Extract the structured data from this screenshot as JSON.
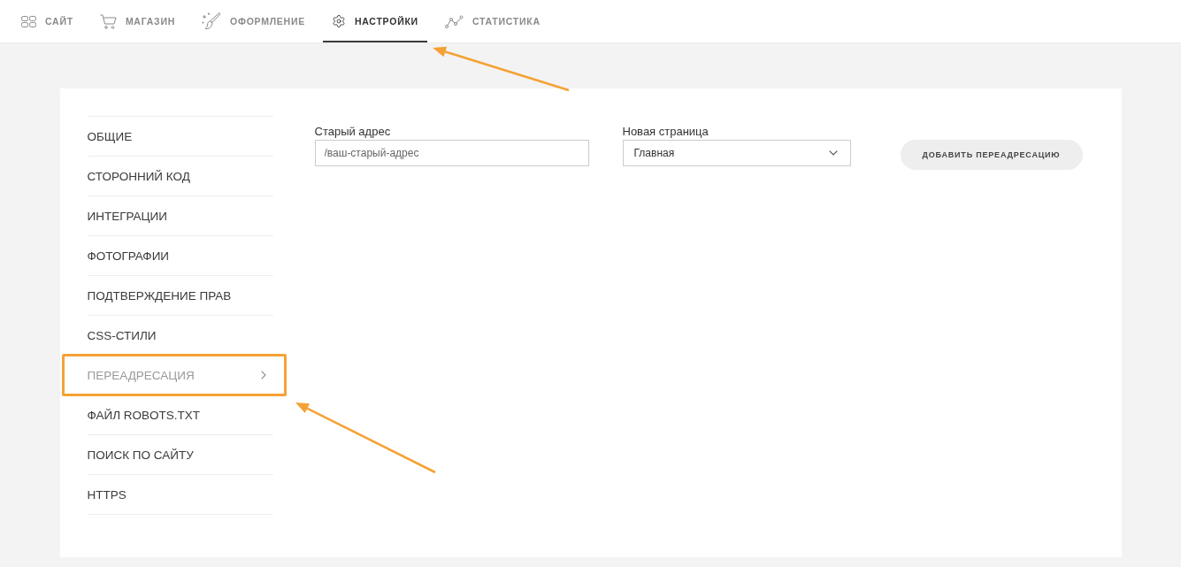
{
  "nav": {
    "pointer_arrow": true,
    "tabs": [
      {
        "label": "САЙТ",
        "selected": false
      },
      {
        "label": "МАГАЗИН",
        "selected": false
      },
      {
        "label": "ОФОРМЛЕНИЕ",
        "selected": false
      },
      {
        "label": "НАСТРОЙКИ",
        "selected": true
      },
      {
        "label": "СТАТИСТИКА",
        "selected": false
      }
    ]
  },
  "settings_menu": {
    "pointer_arrow": true,
    "highlight_frame": true,
    "items": [
      {
        "label": "ОБЩИЕ",
        "selected": false
      },
      {
        "label": "СТОРОННИЙ КОД",
        "selected": false
      },
      {
        "label": "ИНТЕГРАЦИИ",
        "selected": false
      },
      {
        "label": "ФОТОГРАФИИ",
        "selected": false
      },
      {
        "label": "ПОДТВЕРЖДЕНИЕ ПРАВ",
        "selected": false
      },
      {
        "label": "CSS-СТИЛИ",
        "selected": false
      },
      {
        "label": "ПЕРЕАДРЕСАЦИЯ",
        "selected": true
      },
      {
        "label": "ФАЙЛ ROBOTS.TXT",
        "selected": false
      },
      {
        "label": "ПОИСК ПО САЙТУ",
        "selected": false
      },
      {
        "label": "HTTPS",
        "selected": false
      }
    ]
  },
  "redirect_form": {
    "old_address": {
      "label": "Старый адрес",
      "placeholder": "/ваш-старый-адрес"
    },
    "new_page": {
      "label": "Новая страница",
      "value": "Главная"
    },
    "button": "ДОБАВИТЬ ПЕРЕАДРЕСАЦИЮ"
  }
}
